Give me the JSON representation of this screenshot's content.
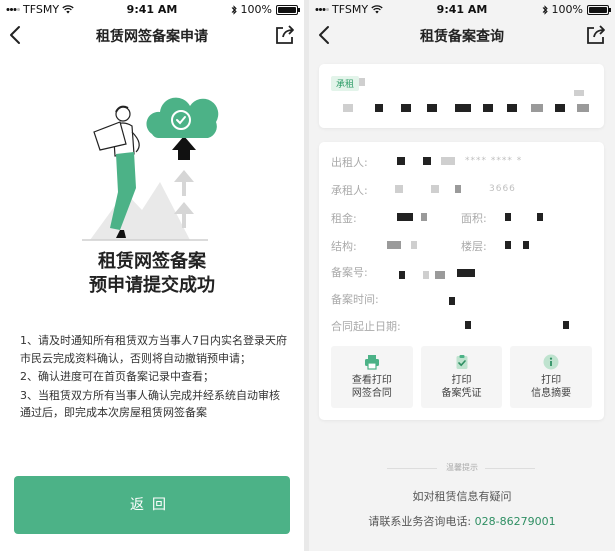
{
  "status_bar": {
    "carrier": "TFSMY",
    "time": "9:41 AM",
    "battery": "100%"
  },
  "left_screen": {
    "title": "租赁网签备案申请",
    "success_line1": "租赁网签备案",
    "success_line2": "预申请提交成功",
    "instructions": [
      "1、请及时通知所有租赁双方当事人7日内实名登录天府市民云完成资料确认，否则将自动撤销预申请；",
      "2、确认进度可在首页备案记录中查看；",
      "3、当租赁双方所有当事人确认完成并经系统自动审核通过后，即完成本次房屋租赁网签备案"
    ],
    "return_button": "返回"
  },
  "right_screen": {
    "title": "租赁备案查询",
    "tag": "承租",
    "fields": {
      "lessor": "出租人:",
      "lessor_masked": "**** **** *",
      "lessee": "承租人:",
      "lessee_partial": "3666",
      "rent": "租金:",
      "area": "面积:",
      "structure": "结构:",
      "floor": "楼层:",
      "record_no": "备案号:",
      "record_time": "备案时间:",
      "contract_period": "合同起止日期:"
    },
    "actions": [
      {
        "line1": "查看打印",
        "line2": "网签合同",
        "icon": "printer-icon"
      },
      {
        "line1": "打印",
        "line2": "备案凭证",
        "icon": "clipboard-check-icon"
      },
      {
        "line1": "打印",
        "line2": "信息摘要",
        "icon": "info-icon"
      }
    ],
    "tip_title": "温馨提示",
    "tip_text": "如对租赁信息有疑问",
    "tip_phone_label": "请联系业务咨询电话:",
    "tip_phone": "028-86279001"
  },
  "colors": {
    "accent": "#4cb287",
    "link": "#2f8f63",
    "tag_bg": "#e3f4ea"
  }
}
